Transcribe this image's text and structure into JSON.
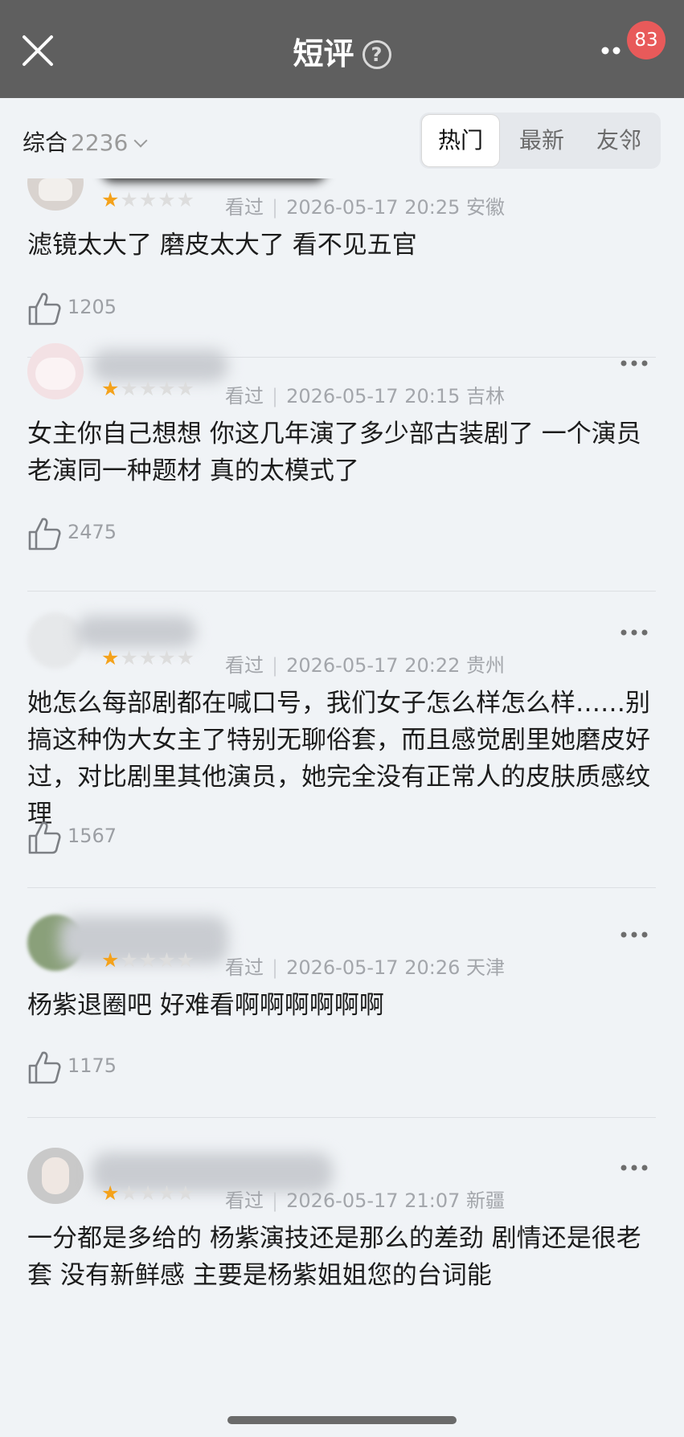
{
  "header": {
    "title": "短评",
    "help_glyph": "?",
    "badge": "83"
  },
  "filter": {
    "sort_label": "综合",
    "count": "2236",
    "tabs": [
      "热门",
      "最新",
      "友邻"
    ]
  },
  "reviews": [
    {
      "rating": 1,
      "status": "看过",
      "datetime": "2026-05-17 20:25",
      "region": "安徽",
      "text": "滤镜太大了 磨皮太大了 看不见五官",
      "likes": "1205"
    },
    {
      "rating": 1,
      "status": "看过",
      "datetime": "2026-05-17 20:15",
      "region": "吉林",
      "text": "女主你自己想想 你这几年演了多少部古装剧了 一个演员老演同一种题材 真的太模式了",
      "likes": "2475"
    },
    {
      "rating": 1,
      "status": "看过",
      "datetime": "2026-05-17 20:22",
      "region": "贵州",
      "text": "她怎么每部剧都在喊口号，我们女子怎么样怎么样……别搞这种伪大女主了特别无聊俗套，而且感觉剧里她磨皮好过，对比剧里其他演员，她完全没有正常人的皮肤质感纹理",
      "likes": "1567"
    },
    {
      "rating": 1,
      "status": "看过",
      "datetime": "2026-05-17 20:26",
      "region": "天津",
      "text": "杨紫退圈吧 好难看啊啊啊啊啊啊",
      "likes": "1175"
    },
    {
      "rating": 1,
      "status": "看过",
      "datetime": "2026-05-17 21:07",
      "region": "新疆",
      "text": "一分都是多给的 杨紫演技还是那么的差劲 剧情还是很老套 没有新鲜感 主要是杨紫姐姐您的台词能",
      "likes": ""
    }
  ],
  "icons": {
    "close": "close-icon",
    "help": "help-icon",
    "more": "more-icon",
    "like": "thumbs-up-icon",
    "star": "star-icon"
  },
  "colors": {
    "header_bg": "#5f5f5f",
    "page_bg": "#f0f3f6",
    "star_on": "#f4a21b",
    "badge": "#e85a5a"
  }
}
